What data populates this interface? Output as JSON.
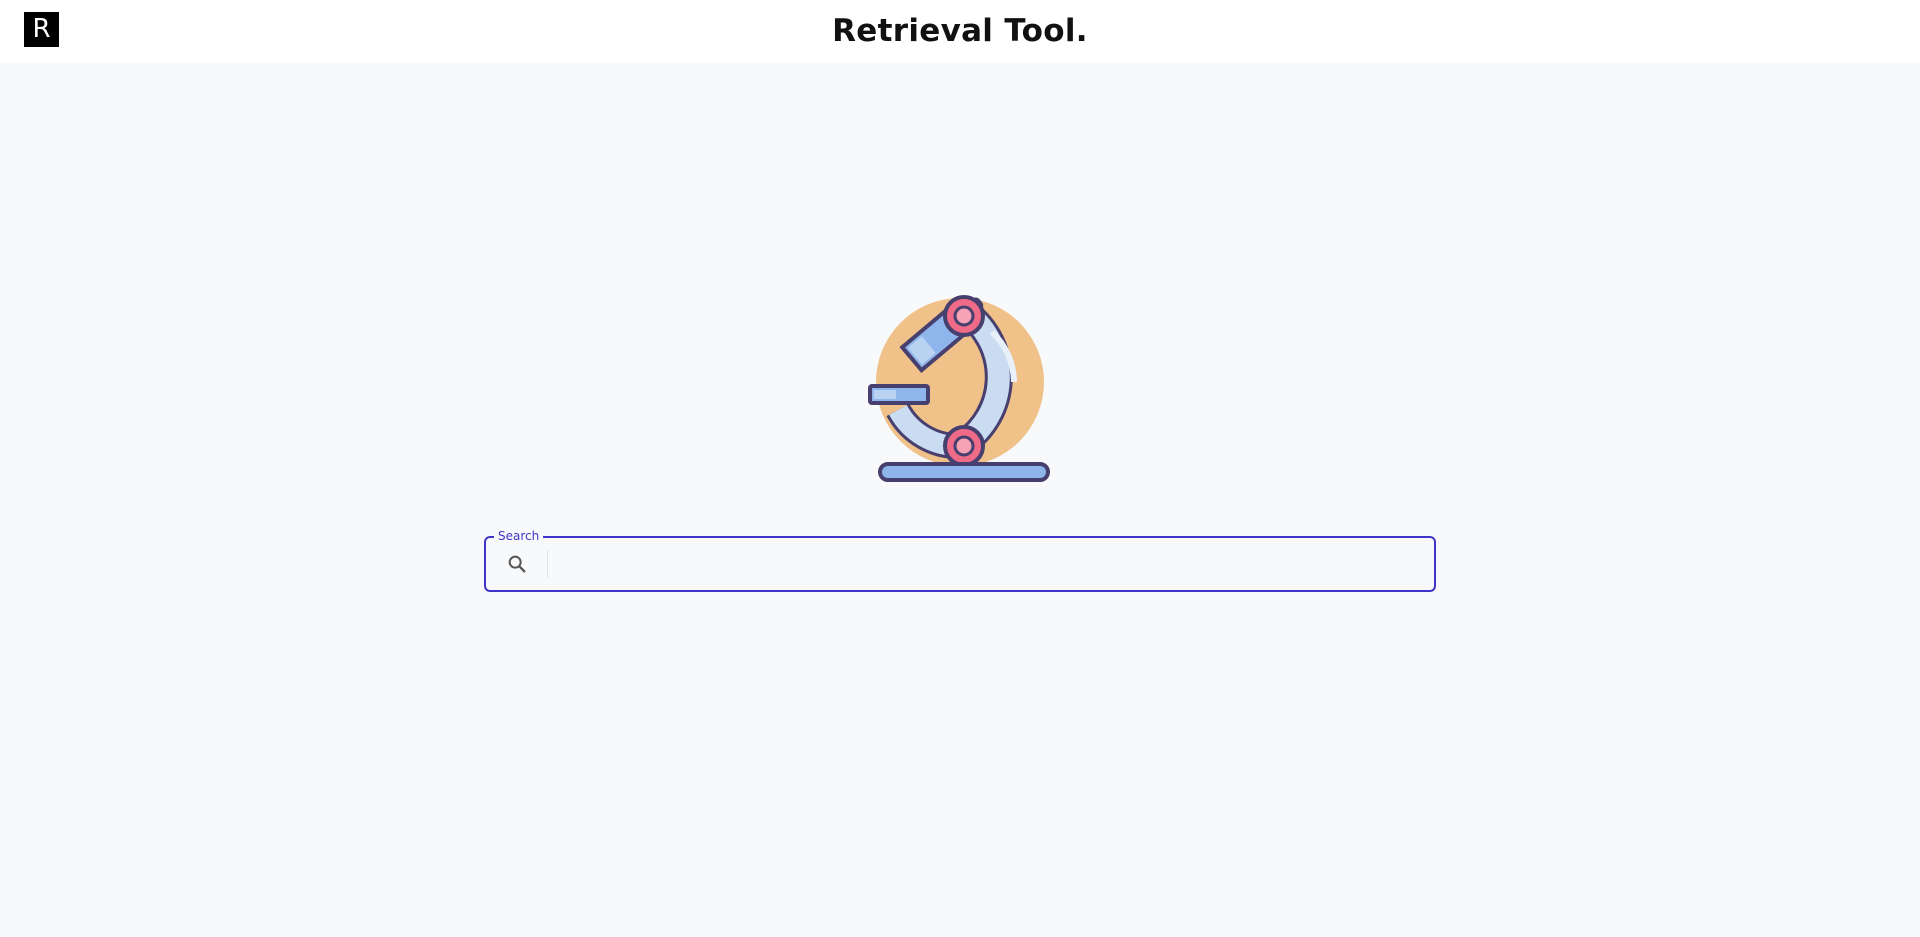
{
  "header": {
    "logo_letter": "R",
    "title": "Retrieval Tool."
  },
  "hero": {
    "icon": "microscope-icon"
  },
  "search": {
    "label": "Search",
    "value": "",
    "placeholder": ""
  },
  "colors": {
    "accent": "#3f35c9",
    "background": "#f8f9fb",
    "header_bg": "#ffffff",
    "logo_bg": "#000000"
  }
}
